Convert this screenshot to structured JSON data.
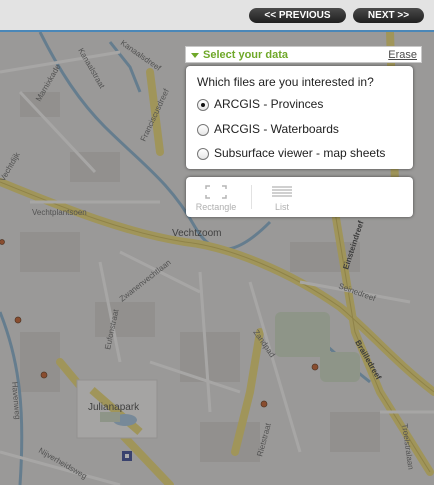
{
  "nav": {
    "previous_label": "<< PREVIOUS",
    "next_label": "NEXT >>"
  },
  "map": {
    "streets": {
      "marnixkade": "Marnixkade",
      "kanaalstraat": "Kanaalstraat",
      "kw_kanaalsdreef": "Kanaalsdreef",
      "franciscusdreef": "Franciscusdreef",
      "vechtplantsoen": "Vechtplantsoen",
      "zwanenvechtlaan": "Zwanenvechtlaan",
      "eikstraat": "Eikstraat",
      "einsteindreef": "Einsteindreef",
      "seinedreef": "Seinedreef",
      "zandpad": "Zandpad",
      "brailledreef": "Brailledreef",
      "eufonstraat": "Eufonstraat",
      "havenweg": "Havenweg",
      "nijverheidsweg": "Nijverheidsweg",
      "rietstraat": "Rietstraat",
      "troelstralaan": "Troelstralaan",
      "vechtdijk": "Vechtdijk"
    },
    "places": {
      "vechtzoom": "Vechtzoom",
      "julianapark": "Julianapark"
    }
  },
  "panel": {
    "title": "Select your data",
    "erase_label": "Erase",
    "question": "Which files are you interested in?",
    "options": [
      {
        "label": "ARCGIS - Provinces",
        "selected": true
      },
      {
        "label": "ARCGIS - Waterboards",
        "selected": false
      },
      {
        "label": "Subsurface viewer - map sheets",
        "selected": false
      }
    ]
  },
  "tools": {
    "rectangle_label": "Rectangle",
    "list_label": "List"
  },
  "colors": {
    "accent_green": "#6fa829",
    "nav_button": "#262626",
    "road_yellow": "#e9d56a",
    "water": "#7fa9c9"
  }
}
